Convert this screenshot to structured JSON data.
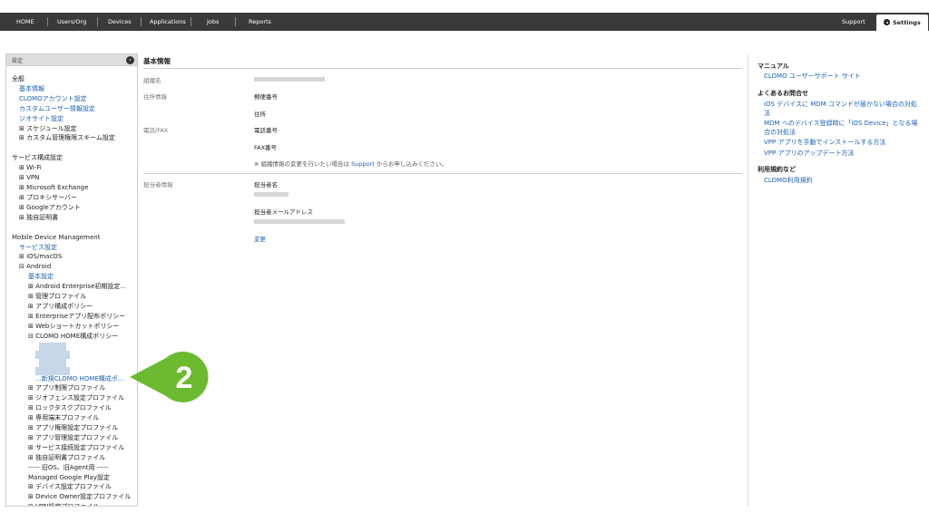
{
  "nav": {
    "items": [
      "HOME",
      "Users/Org",
      "Devices",
      "Applications",
      "Jobs",
      "Reports"
    ],
    "support": "Support",
    "settings": "Settings"
  },
  "sidebar": {
    "header": "設定",
    "collapse_icon": "‹",
    "rows": [
      {
        "text": "全般",
        "type": "section",
        "indent": 0
      },
      {
        "text": "基本情報",
        "type": "link",
        "indent": 1
      },
      {
        "text": "CLOMOアカウント設定",
        "type": "link",
        "indent": 1
      },
      {
        "text": "カスタムユーザー情報設定",
        "type": "link",
        "indent": 1
      },
      {
        "text": "ジオサイト設定",
        "type": "link",
        "indent": 1
      },
      {
        "text": "⊞ スケジュール設定",
        "type": "text",
        "indent": 1
      },
      {
        "text": "⊞ カスタム管理権限スキーム設定",
        "type": "text",
        "indent": 1
      },
      {
        "text": "",
        "type": "gap",
        "indent": 0
      },
      {
        "text": "サービス構成設定",
        "type": "section",
        "indent": 0
      },
      {
        "text": "⊞ Wi-Fi",
        "type": "text",
        "indent": 1
      },
      {
        "text": "⊞ VPN",
        "type": "text",
        "indent": 1
      },
      {
        "text": "⊞ Microsoft Exchange",
        "type": "text",
        "indent": 1
      },
      {
        "text": "⊞ プロキシサーバー",
        "type": "text",
        "indent": 1
      },
      {
        "text": "⊞ Googleアカウント",
        "type": "text",
        "indent": 1
      },
      {
        "text": "⊞ 独自証明書",
        "type": "text",
        "indent": 1
      },
      {
        "text": "",
        "type": "gap",
        "indent": 0
      },
      {
        "text": "Mobile Device Management",
        "type": "section",
        "indent": 0
      },
      {
        "text": "サービス設定",
        "type": "link",
        "indent": 1
      },
      {
        "text": "⊞ iOS/macOS",
        "type": "text",
        "indent": 1
      },
      {
        "text": "⊟ Android",
        "type": "text",
        "indent": 1
      },
      {
        "text": "基本設定",
        "type": "link",
        "indent": 2
      },
      {
        "text": "⊞ Android Enterprise初期設定...",
        "type": "text",
        "indent": 2
      },
      {
        "text": "⊞ 管理プロファイル",
        "type": "text",
        "indent": 2
      },
      {
        "text": "⊞ アプリ構成ポリシー",
        "type": "text",
        "indent": 2
      },
      {
        "text": "⊞ Enterpriseアプリ配布ポリシー",
        "type": "text",
        "indent": 2
      },
      {
        "text": "⊞ Webショートカットポリシー",
        "type": "text",
        "indent": 2
      },
      {
        "text": "⊟ CLOMO HOME構成ポリシー",
        "type": "text",
        "indent": 2
      },
      {
        "text": "",
        "type": "blur",
        "indent": 3
      },
      {
        "text": "",
        "type": "blur",
        "indent": 3
      },
      {
        "text": "",
        "type": "blur",
        "indent": 3
      },
      {
        "text": "",
        "type": "blur",
        "indent": 3
      },
      {
        "text": "...新規CLOMO HOME構成ポ...",
        "type": "link",
        "indent": 3
      },
      {
        "text": "⊞ アプリ制限プロファイル",
        "type": "text",
        "indent": 2
      },
      {
        "text": "⊞ ジオフェンス設定プロファイル",
        "type": "text",
        "indent": 2
      },
      {
        "text": "⊞ ロックタスクプロファイル",
        "type": "text",
        "indent": 2
      },
      {
        "text": "⊞ 専用端末プロファイル",
        "type": "text",
        "indent": 2
      },
      {
        "text": "⊞ アプリ権限設定プロファイル",
        "type": "text",
        "indent": 2
      },
      {
        "text": "⊞ アプリ管理設定プロファイル",
        "type": "text",
        "indent": 2
      },
      {
        "text": "⊞ サービス接続設定プロファイル",
        "type": "text",
        "indent": 2
      },
      {
        "text": "⊞ 独自証明書プロファイル",
        "type": "text",
        "indent": 2
      },
      {
        "text": "----- 旧OS、旧Agent用 -----",
        "type": "text",
        "indent": 2
      },
      {
        "text": "Managed Google Play設定",
        "type": "text",
        "indent": 2
      },
      {
        "text": "⊞ デバイス設定プロファイル",
        "type": "text",
        "indent": 2
      },
      {
        "text": "⊞ Device Owner設定プロファイル",
        "type": "text",
        "indent": 2
      },
      {
        "text": "⊞ VPN設定プロファイル",
        "type": "text",
        "indent": 2
      }
    ]
  },
  "main": {
    "title": "基本情報",
    "org_label": "組織名",
    "address_label": "住所情報",
    "postal_label": "郵便番号",
    "address_field": "住所",
    "phone_label": "電話/FAX",
    "phone_field": "電話番号",
    "fax_field": "FAX番号",
    "note_prefix": "※ 組織情報の変更を行いたい場合は ",
    "note_link": "Support",
    "note_suffix": " からお申し込みください。",
    "contact_label": "担当者情報",
    "contact_name_label": "担当者名",
    "contact_email_label": "担当者メールアドレス",
    "change_link": "変更"
  },
  "right": {
    "manual_head": "マニュアル",
    "manual_link": "CLOMO ユーザーサポート サイト",
    "faq_head": "よくあるお問合せ",
    "faq_links": [
      "iOS デバイスに MDM コマンドが届かない場合の対処法",
      "MDM へのデバイス登録時に「iOS Device」となる場合の対処法",
      "VPP アプリを手動でインストールする方法",
      "VPP アプリのアップデート方法"
    ],
    "terms_head": "利用規約など",
    "terms_link": "CLOMO利用規約"
  },
  "callout": {
    "number": "2",
    "color": "#6cba2f"
  }
}
